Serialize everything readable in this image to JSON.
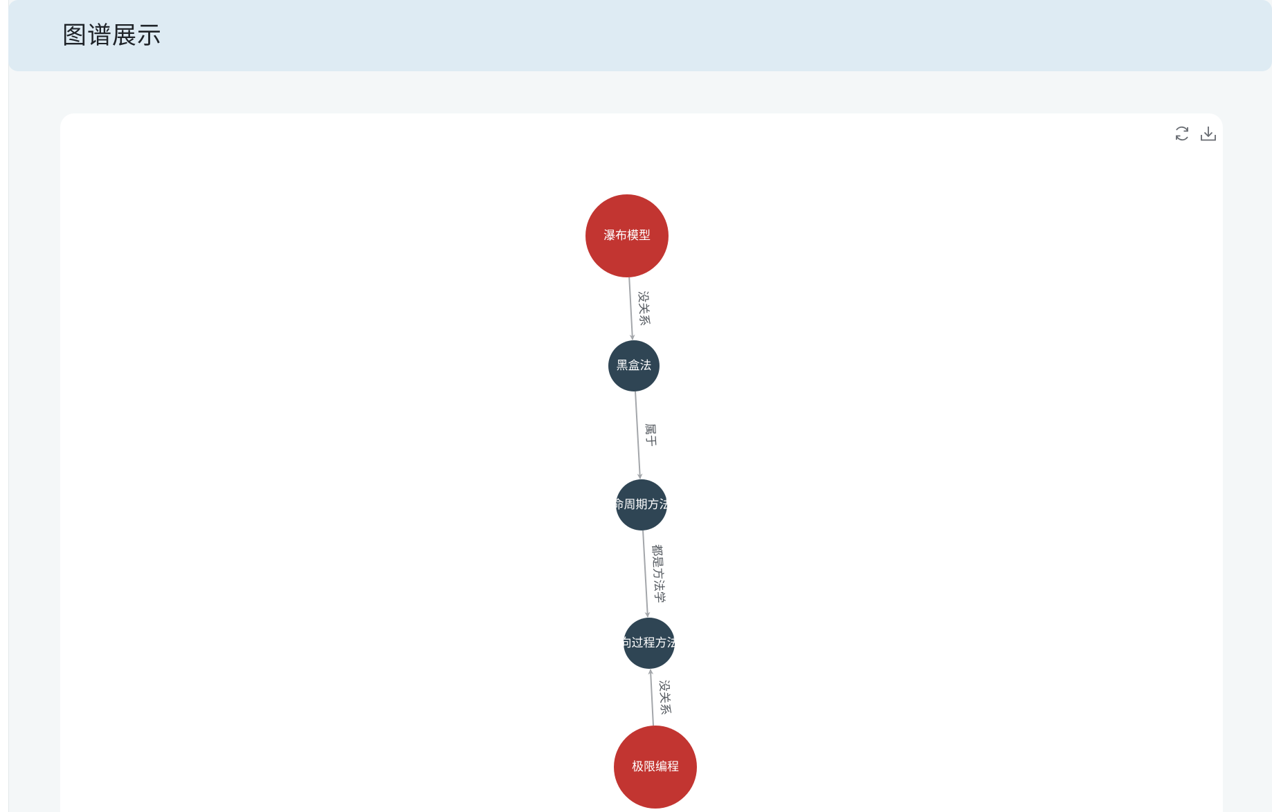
{
  "header": {
    "title": "图谱展示"
  },
  "toolbox": {
    "items": [
      {
        "name": "refresh",
        "icon": "refresh-icon"
      },
      {
        "name": "download",
        "icon": "download-icon"
      }
    ]
  },
  "colors": {
    "red_node": "#c23531",
    "dark_node": "#2f4554",
    "edge": "#a3a6aa",
    "header_bg": "#deebf3"
  },
  "graph": {
    "nodes": [
      {
        "id": "n1",
        "label": "瀑布模型",
        "category": "red"
      },
      {
        "id": "n2",
        "label": "黑盒法",
        "category": "dark"
      },
      {
        "id": "n3",
        "label": "命周期方法",
        "category": "dark"
      },
      {
        "id": "n4",
        "label": "向过程方法",
        "category": "dark"
      },
      {
        "id": "n5",
        "label": "极限编程",
        "category": "red"
      }
    ],
    "edges": [
      {
        "source": "n1",
        "target": "n2",
        "label": "没关系"
      },
      {
        "source": "n2",
        "target": "n3",
        "label": "属于"
      },
      {
        "source": "n3",
        "target": "n4",
        "label": "都是方法学"
      },
      {
        "source": "n5",
        "target": "n4",
        "label": "没关系"
      }
    ]
  }
}
